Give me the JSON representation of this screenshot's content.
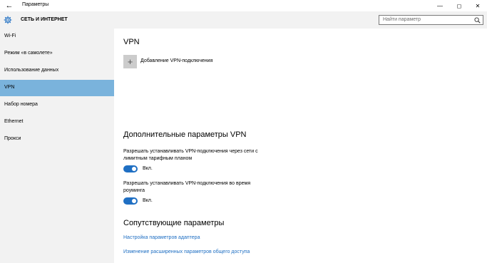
{
  "window": {
    "title": "Параметры",
    "back_glyph": "←",
    "controls": {
      "minimize": "—",
      "maximize": "◻",
      "close": "✕"
    }
  },
  "header": {
    "title": "СЕТЬ И ИНТЕРНЕТ",
    "icon": "gear-icon",
    "search_placeholder": "Найти параметр"
  },
  "sidebar": {
    "items": [
      {
        "label": "Wi-Fi",
        "active": false
      },
      {
        "label": "Режим «в самолете»",
        "active": false
      },
      {
        "label": "Использование данных",
        "active": false
      },
      {
        "label": "VPN",
        "active": true
      },
      {
        "label": "Набор номера",
        "active": false
      },
      {
        "label": "Ethernet",
        "active": false
      },
      {
        "label": "Прокси",
        "active": false
      }
    ]
  },
  "main": {
    "vpn_heading": "VPN",
    "add_vpn_label": "Добавление VPN-подключения",
    "add_glyph": "+",
    "advanced_heading": "Дополнительные параметры VPN",
    "options": [
      {
        "text": "Разрешать устанавливать VPN-подключения через сети с лимитным тарифным планом",
        "state": "Вкл.",
        "on": true
      },
      {
        "text": "Разрешать устанавливать VPN-подключения во время роуминга",
        "state": "Вкл.",
        "on": true
      }
    ],
    "related_heading": "Сопутствующие параметры",
    "links": [
      "Настройка параметров адаптера",
      "Изменение расширенных параметров общего доступа"
    ]
  },
  "colors": {
    "accent": "#1f6fc3",
    "selection": "#7ab3dc",
    "sidebar_bg": "#f2f2f2"
  }
}
